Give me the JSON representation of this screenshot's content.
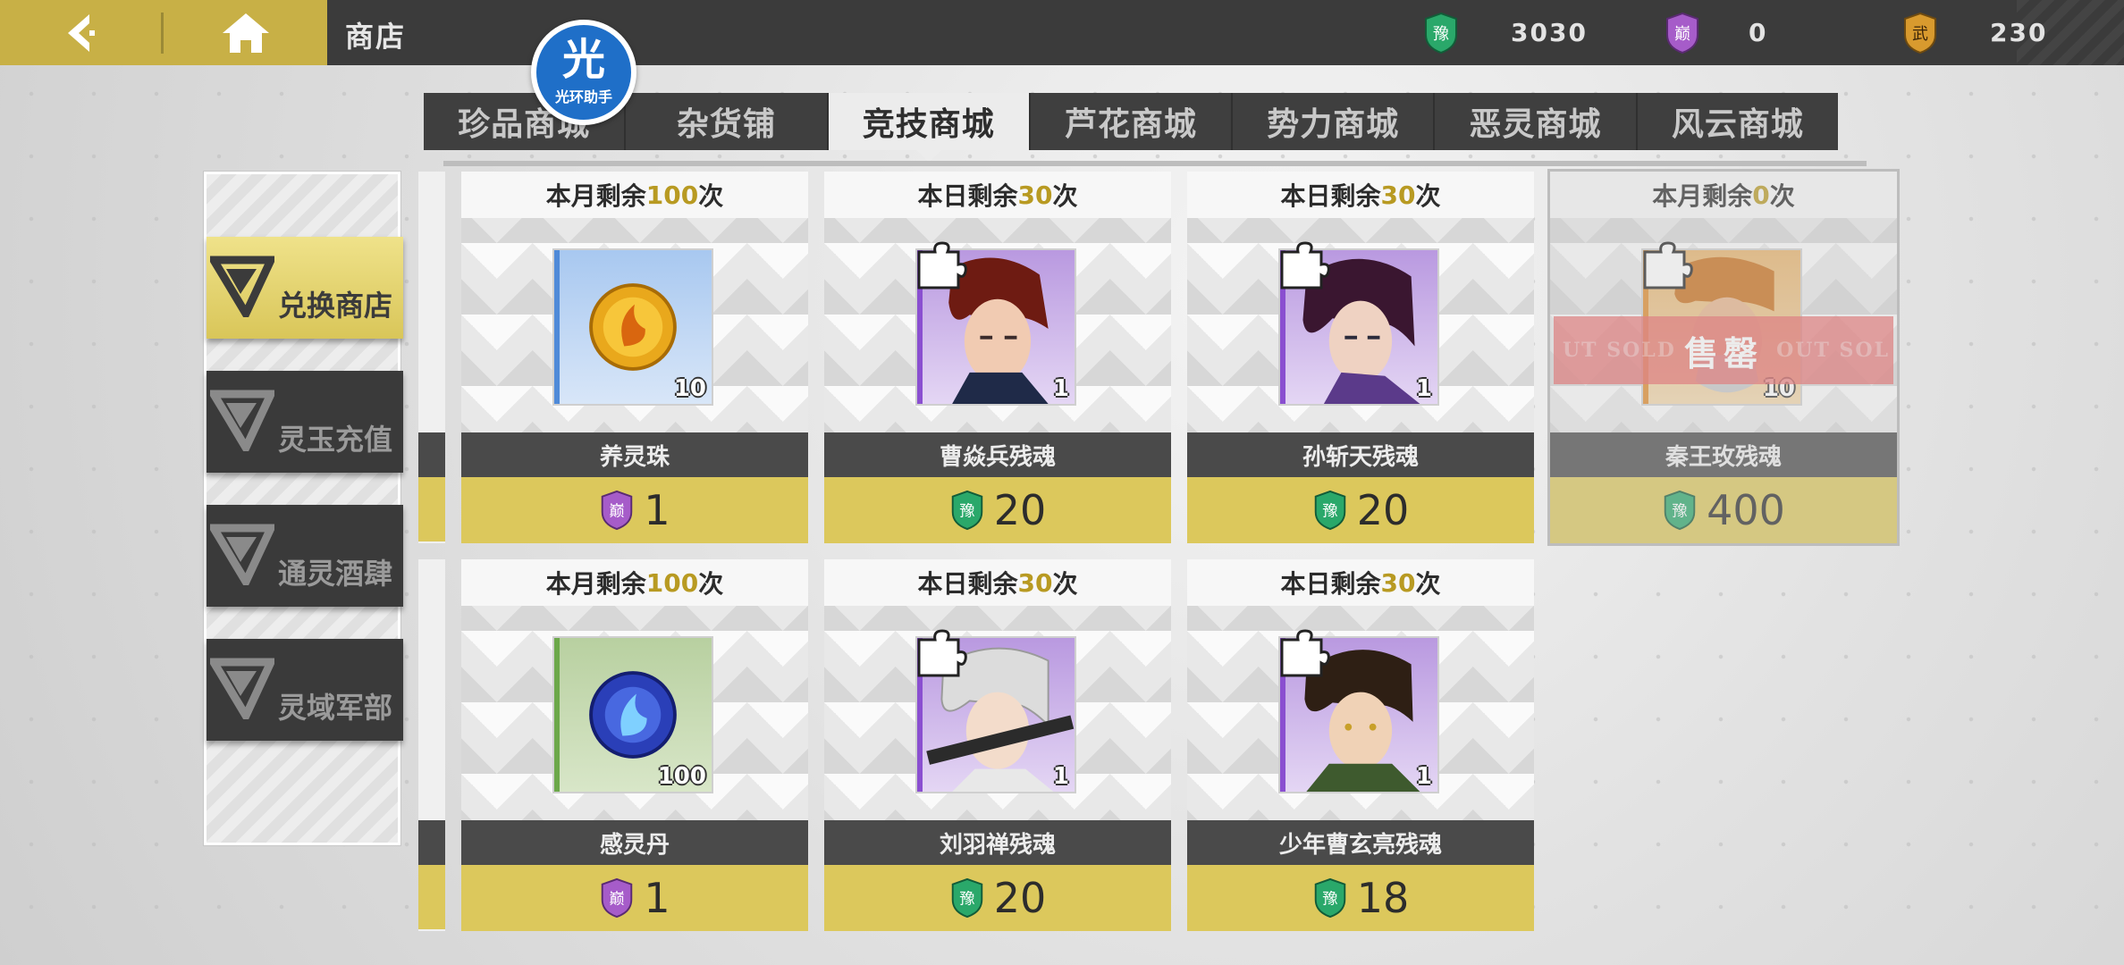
{
  "header": {
    "title": "商店",
    "helper_badge": {
      "big": "光",
      "small": "光环助手"
    },
    "currencies": [
      {
        "icon": "green-shield-icon",
        "glyph": "豫",
        "value": "3030",
        "color": "#2aa86a"
      },
      {
        "icon": "purple-shield-icon",
        "glyph": "巅",
        "value": "0",
        "color": "#a65cc9"
      },
      {
        "icon": "orange-shield-icon",
        "glyph": "武",
        "value": "230",
        "color": "#d89a2e"
      }
    ]
  },
  "tabs": [
    {
      "label": "珍品商城",
      "active": false
    },
    {
      "label": "杂货铺",
      "active": false
    },
    {
      "label": "竞技商城",
      "active": true
    },
    {
      "label": "芦花商城",
      "active": false
    },
    {
      "label": "势力商城",
      "active": false
    },
    {
      "label": "恶灵商城",
      "active": false
    },
    {
      "label": "风云商城",
      "active": false
    }
  ],
  "sidemenu": [
    {
      "label": "兑换商店",
      "active": true
    },
    {
      "label": "灵玉充值",
      "active": false
    },
    {
      "label": "通灵酒肆",
      "active": false
    },
    {
      "label": "灵域军部",
      "active": false
    }
  ],
  "products": [
    {
      "limit_prefix": "本月剩余",
      "limit_num": "100",
      "limit_suffix": "次",
      "name": "养灵珠",
      "qty": "10",
      "price": "1",
      "price_currency": "purple-shield-icon",
      "icon": "golden-orb-icon",
      "soldout": false
    },
    {
      "limit_prefix": "本日剩余",
      "limit_num": "30",
      "limit_suffix": "次",
      "name": "曹焱兵残魂",
      "qty": "1",
      "price": "20",
      "price_currency": "green-shield-icon",
      "icon": "character-portrait-icon",
      "soldout": false
    },
    {
      "limit_prefix": "本日剩余",
      "limit_num": "30",
      "limit_suffix": "次",
      "name": "孙斩天残魂",
      "qty": "1",
      "price": "20",
      "price_currency": "green-shield-icon",
      "icon": "character-portrait-icon",
      "soldout": false
    },
    {
      "limit_prefix": "本月剩余",
      "limit_num": "0",
      "limit_suffix": "次",
      "name": "秦王玫残魂",
      "qty": "10",
      "price": "400",
      "price_currency": "green-shield-icon",
      "icon": "character-portrait-icon",
      "soldout": true,
      "soldout_label": "售罄",
      "soldout_ghost_left": "UT SOLD",
      "soldout_ghost_right": "OUT SOL"
    },
    {
      "limit_prefix": "本月剩余",
      "limit_num": "100",
      "limit_suffix": "次",
      "name": "感灵丹",
      "qty": "100",
      "price": "1",
      "price_currency": "purple-shield-icon",
      "icon": "blue-orb-icon",
      "soldout": false
    },
    {
      "limit_prefix": "本日剩余",
      "limit_num": "30",
      "limit_suffix": "次",
      "name": "刘羽禅残魂",
      "qty": "1",
      "price": "20",
      "price_currency": "green-shield-icon",
      "icon": "character-portrait-icon",
      "soldout": false
    },
    {
      "limit_prefix": "本日剩余",
      "limit_num": "30",
      "limit_suffix": "次",
      "name": "少年曹玄亮残魂",
      "qty": "1",
      "price": "18",
      "price_currency": "green-shield-icon",
      "icon": "character-portrait-icon",
      "soldout": false
    }
  ]
}
